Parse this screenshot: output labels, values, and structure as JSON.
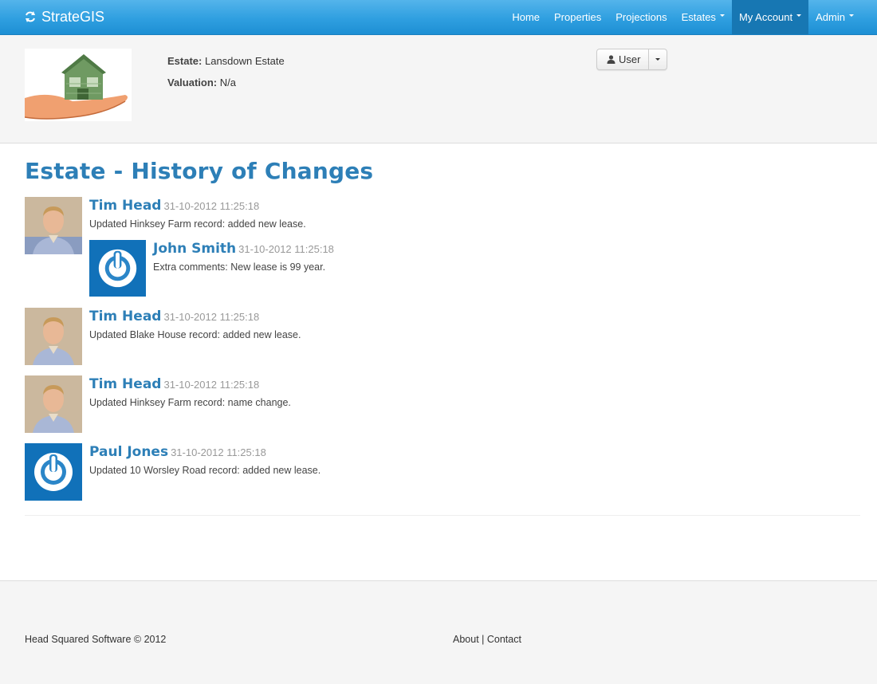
{
  "navbar": {
    "brand": "StrateGIS",
    "items": [
      {
        "label": "Home"
      },
      {
        "label": "Properties"
      },
      {
        "label": "Projections"
      },
      {
        "label": "Estates"
      },
      {
        "label": "My Account"
      },
      {
        "label": "Admin"
      }
    ],
    "active_item": "My Account",
    "accent_color": "#2f9fe0"
  },
  "header": {
    "estate_label": "Estate:",
    "estate_value": "Lansdown Estate",
    "valuation_label": "Valuation:",
    "valuation_value": "N/a",
    "user_button": "User"
  },
  "main": {
    "title": "Estate - History of Changes",
    "entries": [
      {
        "name": "Tim Head",
        "time": "31-10-2012 11:25:18",
        "message": "Updated Hinksey Farm record: added new lease.",
        "avatar": "photo-avatar"
      },
      {
        "name": "John Smith",
        "time": "31-10-2012 11:25:18",
        "message": "Extra comments: New lease is 99 year.",
        "avatar": "power-avatar"
      },
      {
        "name": "Tim Head",
        "time": "31-10-2012 11:25:18",
        "message": "Updated Blake House record: added new lease.",
        "avatar": "photo-avatar"
      },
      {
        "name": "Tim Head",
        "time": "31-10-2012 11:25:18",
        "message": "Updated Hinksey Farm record: name change.",
        "avatar": "photo-avatar"
      },
      {
        "name": "Paul Jones",
        "time": "31-10-2012 11:25:18",
        "message": "Updated 10 Worsley Road record: added new lease.",
        "avatar": "power-avatar"
      }
    ]
  },
  "footer": {
    "copyright": "Head Squared Software © 2012",
    "about": "About",
    "separator": " | ",
    "contact": "Contact"
  }
}
